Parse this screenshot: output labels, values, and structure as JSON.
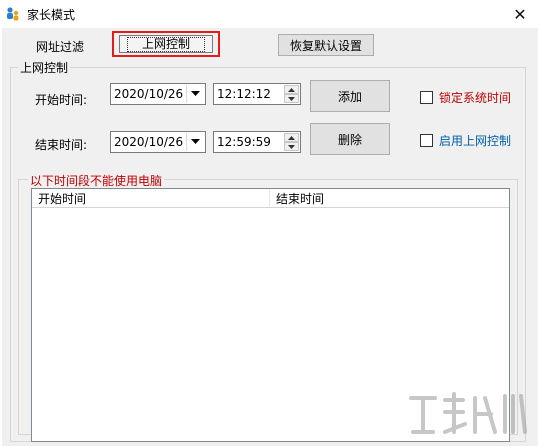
{
  "window": {
    "title": "家长模式"
  },
  "tabs": {
    "filter": "网址过滤",
    "control": "上网控制",
    "reset": "恢复默认设置"
  },
  "group": {
    "title": "上网控制"
  },
  "start": {
    "label": "开始时间:",
    "date": "2020/10/26",
    "time": "12:12:12"
  },
  "end": {
    "label": "结束时间:",
    "date": "2020/10/26",
    "time": "12:59:59"
  },
  "buttons": {
    "add": "添加",
    "delete": "删除"
  },
  "checks": {
    "lock_time": {
      "label": "锁定系统时间",
      "color": "#c00000"
    },
    "enable_control": {
      "label": "启用上网控制",
      "color": "#0060a8"
    }
  },
  "blocked": {
    "title": "以下时间段不能使用电脑",
    "columns": [
      "开始时间",
      "结束时间"
    ]
  },
  "colors": {
    "highlight": "#e81b1b"
  }
}
